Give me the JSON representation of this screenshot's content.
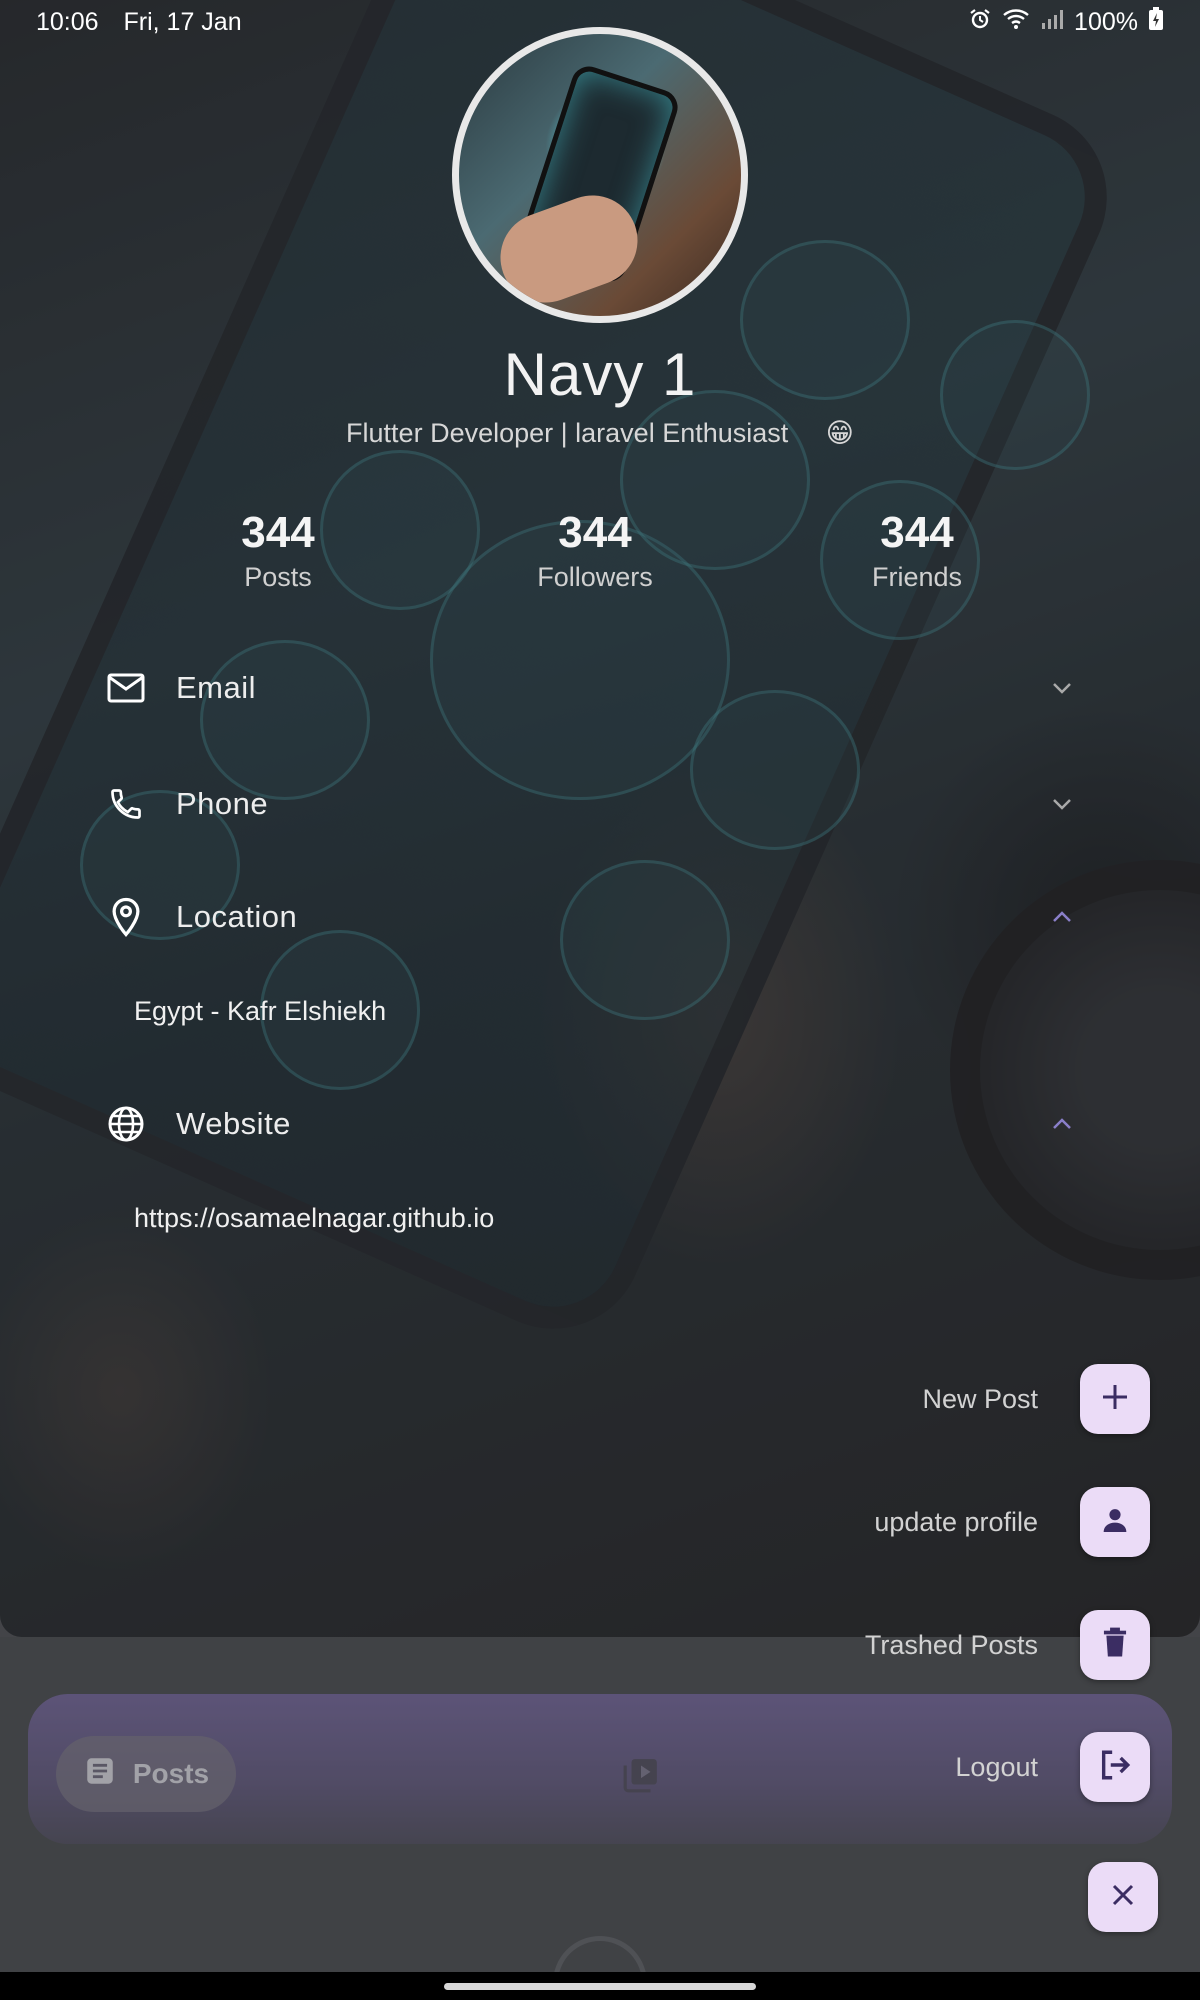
{
  "status_bar": {
    "time": "10:06",
    "date": "Fri, 17 Jan",
    "battery": "100%",
    "icons": [
      "alarm-icon",
      "wifi-icon",
      "signal-icon",
      "battery-charging-icon"
    ]
  },
  "profile": {
    "name": "Navy 1",
    "bio": "Flutter Developer | laravel Enthusiast",
    "bio_emoji": "😁",
    "stats": [
      {
        "value": "344",
        "label": "Posts"
      },
      {
        "value": "344",
        "label": "Followers"
      },
      {
        "value": "344",
        "label": "Friends"
      }
    ]
  },
  "info": {
    "email": {
      "label": "Email",
      "icon": "mail-icon",
      "expanded": false
    },
    "phone": {
      "label": "Phone",
      "icon": "phone-icon",
      "expanded": false
    },
    "location": {
      "label": "Location",
      "icon": "location-pin-icon",
      "expanded": true,
      "value": "Egypt - Kafr Elshiekh"
    },
    "website": {
      "label": "Website",
      "icon": "globe-icon",
      "expanded": true,
      "value": "https://osamaelnagar.github.io"
    }
  },
  "fab_menu": {
    "new_post": "New Post",
    "update_profile": "update profile",
    "trashed_posts": "Trashed Posts",
    "logout": "Logout"
  },
  "bottom_nav": {
    "posts_label": "Posts",
    "items": [
      "posts-tab",
      "videos-tab"
    ]
  },
  "colors": {
    "fab_background": "#ebdcf7",
    "fab_icon": "#3b2d63",
    "nav_background": "#6e5f95",
    "accent_chevron": "#8a7fc9"
  }
}
